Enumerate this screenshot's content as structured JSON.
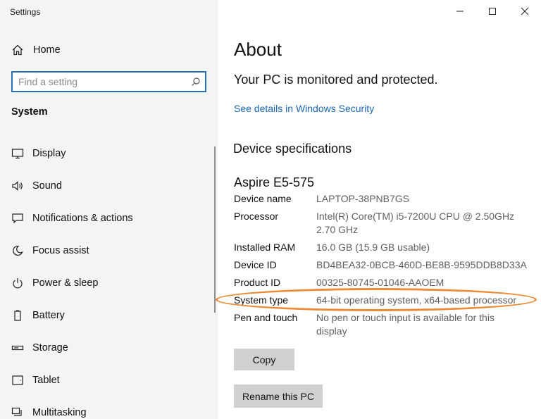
{
  "window": {
    "title": "Settings",
    "controls": [
      "minimize",
      "maximize",
      "close"
    ]
  },
  "sidebar": {
    "home_label": "Home",
    "search": {
      "placeholder": "Find a setting",
      "value": ""
    },
    "section_title": "System",
    "items": [
      {
        "label": "Display",
        "icon": "display-icon"
      },
      {
        "label": "Sound",
        "icon": "speaker-icon"
      },
      {
        "label": "Notifications & actions",
        "icon": "notification-icon"
      },
      {
        "label": "Focus assist",
        "icon": "moon-icon"
      },
      {
        "label": "Power & sleep",
        "icon": "power-icon"
      },
      {
        "label": "Battery",
        "icon": "battery-icon"
      },
      {
        "label": "Storage",
        "icon": "storage-icon"
      },
      {
        "label": "Tablet",
        "icon": "tablet-icon"
      },
      {
        "label": "Multitasking",
        "icon": "multitasking-icon"
      }
    ]
  },
  "main": {
    "title": "About",
    "protection_status": "Your PC is monitored and protected.",
    "security_link": "See details in Windows Security",
    "device_spec_heading": "Device specifications",
    "device_model": "Aspire E5-575",
    "specs": [
      {
        "label": "Device name",
        "value": "LAPTOP-38PNB7GS"
      },
      {
        "label": "Processor",
        "value": "Intel(R) Core(TM) i5-7200U CPU @ 2.50GHz 2.70 GHz"
      },
      {
        "label": "Installed RAM",
        "value": "16.0 GB (15.9 GB usable)"
      },
      {
        "label": "Device ID",
        "value": "BD4BEA32-0BCB-460D-BE8B-9595DDB8D33A"
      },
      {
        "label": "Product ID",
        "value": "00325-80745-01046-AAOEM"
      },
      {
        "label": "System type",
        "value": "64-bit operating system, x64-based processor"
      },
      {
        "label": "Pen and touch",
        "value": "No pen or touch input is available for this display"
      }
    ],
    "copy_button": "Copy",
    "rename_button": "Rename this PC"
  },
  "colors": {
    "accent": "#1a66b3",
    "search_border": "#2a6fb8",
    "highlight": "#ec8a35",
    "sidebar_bg": "#f2f4f5",
    "button_bg": "#d0d0d0"
  }
}
